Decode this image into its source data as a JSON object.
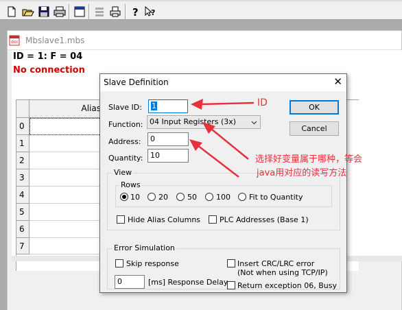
{
  "toolbar": {
    "buttons": [
      "new-icon",
      "open-icon",
      "save-icon",
      "print-icon",
      "window-icon",
      "connect-icon",
      "printer-icon",
      "help-icon",
      "context-help-icon"
    ]
  },
  "child_window": {
    "title": "Mbslave1.mbs",
    "id_line": "ID = 1: F = 04",
    "status": "No connection",
    "grid": {
      "header": "Alias",
      "rows": [
        "0",
        "1",
        "2",
        "3",
        "4",
        "5",
        "6",
        "7"
      ]
    }
  },
  "dialog": {
    "title": "Slave Definition",
    "close": "✕",
    "slave_id_label": "Slave ID:",
    "slave_id_value": "1",
    "function_label": "Function:",
    "function_value": "04 Input Registers (3x)",
    "address_label": "Address:",
    "address_value": "0",
    "quantity_label": "Quantity:",
    "quantity_value": "10",
    "ok_label": "OK",
    "cancel_label": "Cancel",
    "view": {
      "legend": "View",
      "rows_legend": "Rows",
      "row_options": [
        "10",
        "20",
        "50",
        "100",
        "Fit to Quantity"
      ],
      "selected_row_option": "10",
      "hide_alias": "Hide Alias Columns",
      "plc_addresses": "PLC Addresses (Base 1)"
    },
    "error_sim": {
      "legend": "Error Simulation",
      "skip_response": "Skip response",
      "delay_value": "0",
      "delay_label": "[ms] Response Delay",
      "insert_crc": "Insert CRC/LRC error",
      "insert_crc_note": "(Not when using TCP/IP)",
      "return_exception": "Return exception 06, Busy"
    }
  },
  "annotations": {
    "id_note": "ID",
    "function_note_line1": "选择好变量属于哪种，等会",
    "function_note_line2": "java用对应的读写方法",
    "color": "#e8303a"
  }
}
